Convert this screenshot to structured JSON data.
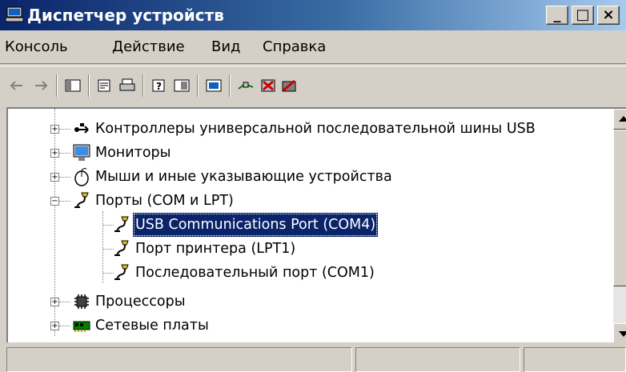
{
  "window": {
    "title": "Диспетчер устройств",
    "icons": [
      "computer-icon"
    ],
    "controls": {
      "minimize": "_",
      "maximize": "□",
      "close": "×"
    }
  },
  "menu": [
    "Консоль",
    "Действие",
    "Вид",
    "Справка"
  ],
  "toolbar": {
    "icons": [
      "back-arrow-icon",
      "forward-arrow-icon",
      "show-hide-console-tree-icon",
      "properties-icon",
      "print-icon",
      "help-icon",
      "details-view-icon",
      "scan-hardware-icon",
      "update-driver-icon",
      "uninstall-icon",
      "disable-icon"
    ]
  },
  "tree": {
    "items": [
      {
        "label": "Контроллеры универсальной последовательной шины USB",
        "icon": "usb-controller-icon",
        "expander": "+"
      },
      {
        "label": "Мониторы",
        "icon": "monitor-icon",
        "expander": "+"
      },
      {
        "label": "Мыши и иные указывающие устройства",
        "icon": "mouse-icon",
        "expander": "+"
      },
      {
        "label": "Порты (COM и LPT)",
        "icon": "port-icon",
        "expander": "−",
        "children": [
          {
            "label": "USB Communications Port (COM4)",
            "icon": "port-icon",
            "selected": true
          },
          {
            "label": "Порт принтера (LPT1)",
            "icon": "port-icon"
          },
          {
            "label": "Последовательный порт (COM1)",
            "icon": "port-icon"
          }
        ]
      },
      {
        "label": "Процессоры",
        "icon": "processor-icon",
        "expander": "+"
      },
      {
        "label": "Сетевые платы",
        "icon": "network-card-icon",
        "expander": "+"
      }
    ]
  },
  "statusbar": {
    "panels": [
      "",
      "",
      ""
    ]
  }
}
